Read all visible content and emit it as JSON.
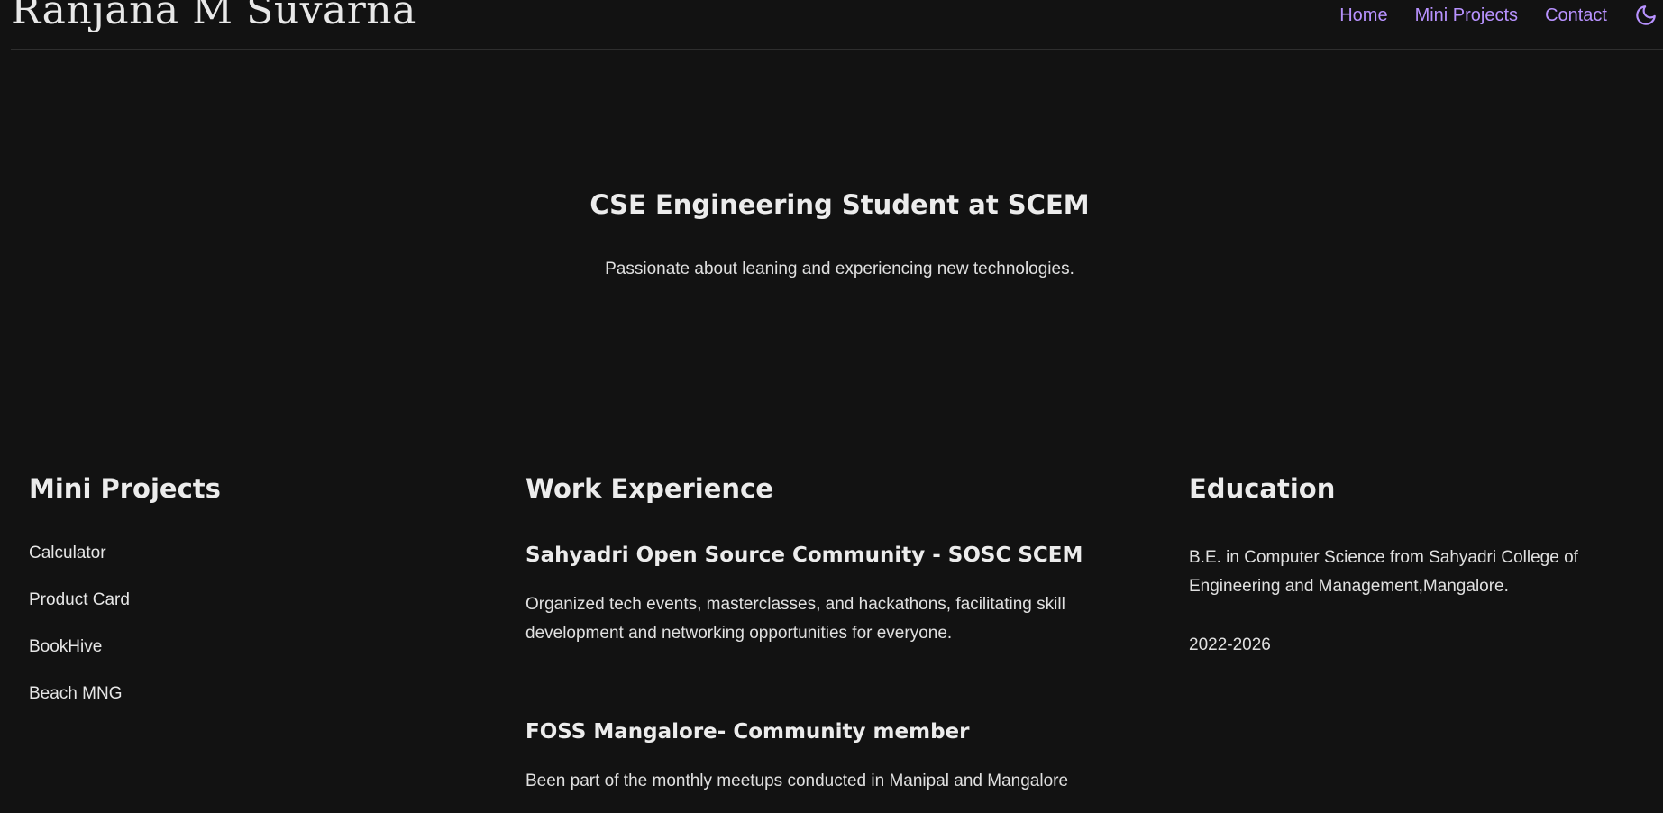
{
  "header": {
    "site_title": "Ranjana M Suvarna",
    "nav": [
      {
        "label": "Home"
      },
      {
        "label": "Mini Projects"
      },
      {
        "label": "Contact"
      }
    ],
    "theme_icon": "moon-icon",
    "accent_color": "#b892ff"
  },
  "hero": {
    "title": "CSE Engineering Student at SCEM",
    "subtitle": "Passionate about leaning and experiencing new technologies."
  },
  "projects": {
    "heading": "Mini Projects",
    "items": [
      {
        "label": "Calculator"
      },
      {
        "label": "Product Card"
      },
      {
        "label": "BookHive"
      },
      {
        "label": "Beach MNG"
      }
    ]
  },
  "work": {
    "heading": "Work Experience",
    "jobs": [
      {
        "title": "Sahyadri Open Source Community - SOSC SCEM",
        "description": "Organized tech events, masterclasses, and hackathons, facilitating skill development and networking opportunities for everyone."
      },
      {
        "title": "FOSS Mangalore- Community member",
        "description": "Been part of the monthly meetups conducted in Manipal and Mangalore"
      }
    ]
  },
  "education": {
    "heading": "Education",
    "degree": "B.E. in Computer Science from Sahyadri College of Engineering and Management,Mangalore.",
    "years": "2022-2026"
  },
  "colors": {
    "background": "#121212",
    "text": "#e6e6e6"
  }
}
